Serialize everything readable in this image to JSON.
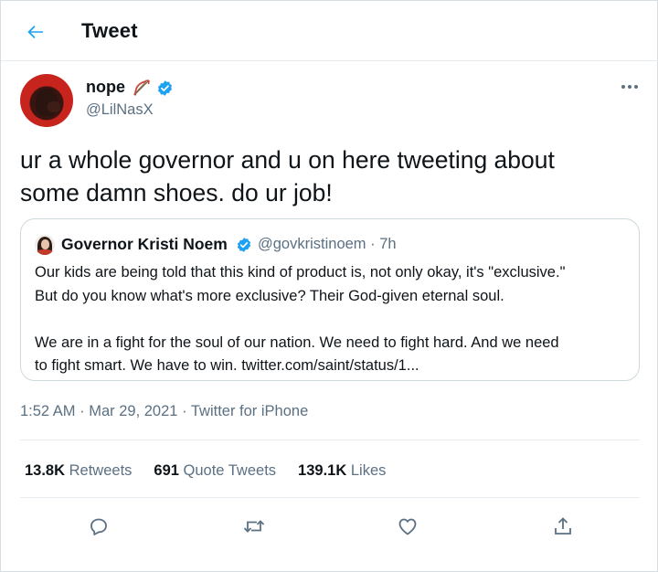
{
  "header": {
    "title": "Tweet"
  },
  "author": {
    "display_name": "nope",
    "handle": "@LilNasX",
    "verified": true
  },
  "tweet": {
    "text_line1": "ur a whole governor and u on here tweeting about",
    "text_line2": "some damn shoes. do ur job!"
  },
  "quoted": {
    "name": "Governor Kristi Noem",
    "handle_time": "@govkristinoem · 7h",
    "para1_line1": "Our kids are being told that this kind of product is, not only okay, it's \"exclusive.\"",
    "para1_line2": "But do you know what's more exclusive? Their God-given eternal soul.",
    "para2_line1": "We are in a fight for the soul of our nation. We need to fight hard. And we need",
    "para2_line2": "to fight smart. We have to win. twitter.com/saint/status/1..."
  },
  "meta": {
    "time": "1:52 AM",
    "separator": "·",
    "date": "Mar 29, 2021",
    "source": "Twitter for iPhone"
  },
  "stats": {
    "retweets_count": "13.8K",
    "retweets_label": "Retweets",
    "quotes_count": "691",
    "quotes_label": "Quote Tweets",
    "likes_count": "139.1K",
    "likes_label": "Likes"
  },
  "colors": {
    "accent": "#1da1f2",
    "secondary_text": "#5b7083",
    "primary_text": "#0f1419",
    "border": "#e6ecf0"
  },
  "icons": {
    "back": "arrow-left-icon",
    "more": "more-horizontal-icon",
    "verified": "verified-badge-icon",
    "bow": "bow-and-arrow-icon",
    "reply": "reply-icon",
    "retweet": "retweet-icon",
    "like": "heart-icon",
    "share": "share-icon"
  }
}
